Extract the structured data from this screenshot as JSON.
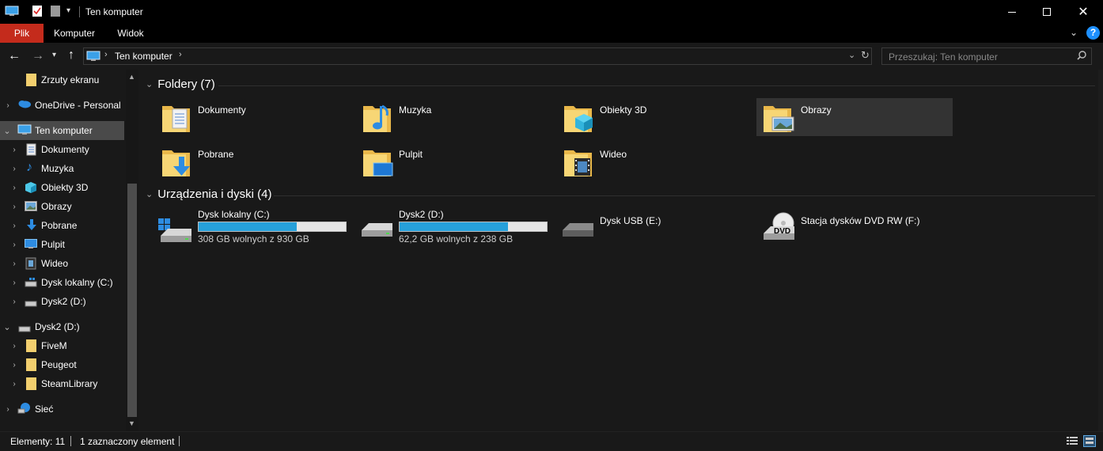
{
  "window": {
    "title": "Ten komputer",
    "minimize_icon": "minimize-icon",
    "maximize_icon": "maximize-icon",
    "close_icon": "close-icon"
  },
  "ribbon": {
    "tabs": [
      {
        "label": "Plik",
        "active": true
      },
      {
        "label": "Komputer"
      },
      {
        "label": "Widok"
      }
    ],
    "accent": "#c42b1c",
    "help_color": "#1e90ff"
  },
  "address": {
    "path_root_icon": "computer-icon",
    "path": [
      "Ten komputer"
    ],
    "search_placeholder": "Przeszukaj: Ten komputer"
  },
  "navigation": {
    "items": [
      {
        "label": "Zrzuty ekranu",
        "icon": "folder-icon",
        "level": 1,
        "expandable": false
      },
      {
        "label": "OneDrive - Personal",
        "icon": "onedrive-icon",
        "level": 0,
        "expandable": true
      },
      {
        "label": "Ten komputer",
        "icon": "computer-icon",
        "level": 0,
        "expandable": true,
        "expanded": true,
        "selected": true
      },
      {
        "label": "Dokumenty",
        "icon": "documents-icon",
        "level": 1,
        "expandable": true
      },
      {
        "label": "Muzyka",
        "icon": "music-icon",
        "level": 1,
        "expandable": true
      },
      {
        "label": "Obiekty 3D",
        "icon": "objects-3d-icon",
        "level": 1,
        "expandable": true
      },
      {
        "label": "Obrazy",
        "icon": "pictures-icon",
        "level": 1,
        "expandable": true
      },
      {
        "label": "Pobrane",
        "icon": "downloads-icon",
        "level": 1,
        "expandable": true
      },
      {
        "label": "Pulpit",
        "icon": "desktop-icon",
        "level": 1,
        "expandable": true
      },
      {
        "label": "Wideo",
        "icon": "videos-icon",
        "level": 1,
        "expandable": true
      },
      {
        "label": "Dysk lokalny (C:)",
        "icon": "drive-icon",
        "level": 1,
        "expandable": true
      },
      {
        "label": "Dysk2 (D:)",
        "icon": "drive-icon",
        "level": 1,
        "expandable": true
      },
      {
        "label": "Dysk2 (D:)",
        "icon": "drive-icon",
        "level": 0,
        "expandable": true,
        "expanded": true
      },
      {
        "label": "FiveM",
        "icon": "folder-icon",
        "level": 1,
        "expandable": true
      },
      {
        "label": "Peugeot",
        "icon": "folder-icon",
        "level": 1,
        "expandable": true
      },
      {
        "label": "SteamLibrary",
        "icon": "folder-icon",
        "level": 1,
        "expandable": true
      },
      {
        "label": "Sieć",
        "icon": "network-icon",
        "level": 0,
        "expandable": true
      }
    ]
  },
  "content": {
    "folders_header": "Foldery (7)",
    "folders": [
      {
        "label": "Dokumenty",
        "icon": "documents-folder-icon"
      },
      {
        "label": "Muzyka",
        "icon": "music-folder-icon"
      },
      {
        "label": "Obiekty 3D",
        "icon": "objects-3d-folder-icon"
      },
      {
        "label": "Obrazy",
        "icon": "pictures-folder-icon",
        "selected": true
      },
      {
        "label": "Pobrane",
        "icon": "downloads-folder-icon"
      },
      {
        "label": "Pulpit",
        "icon": "desktop-folder-icon"
      },
      {
        "label": "Wideo",
        "icon": "videos-folder-icon"
      }
    ],
    "drives_header": "Urządzenia i dyski (4)",
    "drives": [
      {
        "label": "Dysk lokalny (C:)",
        "icon": "windows-drive-icon",
        "free_text": "308 GB wolnych z 930 GB",
        "used_fraction": 0.669
      },
      {
        "label": "Dysk2 (D:)",
        "icon": "hard-drive-icon",
        "free_text": "62,2 GB wolnych z 238 GB",
        "used_fraction": 0.739
      },
      {
        "label": "Dysk USB (E:)",
        "icon": "usb-drive-icon"
      },
      {
        "label": "Stacja dysków DVD RW (F:)",
        "icon": "dvd-drive-icon",
        "badge": "DVD"
      }
    ]
  },
  "status": {
    "items_count": "Elementy: 11",
    "selected": "1 zaznaczony element"
  }
}
